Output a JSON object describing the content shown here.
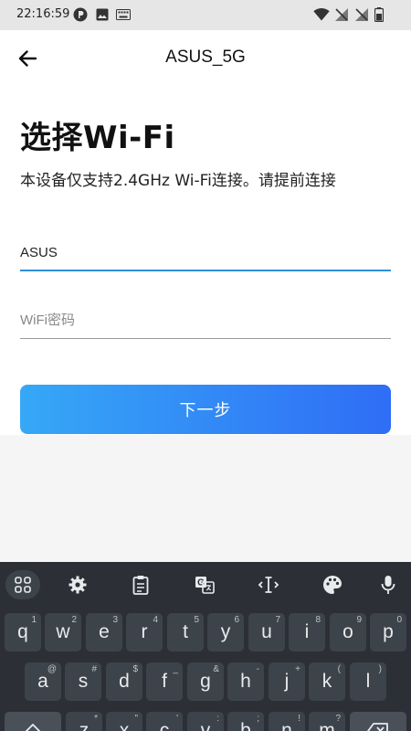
{
  "status_bar": {
    "time": "22:16:59",
    "notification_icons": [
      "app-p-icon",
      "image-icon",
      "keyboard-icon"
    ],
    "system_icons": [
      "wifi-icon",
      "signal-off-icon",
      "signal-off-icon",
      "battery-icon"
    ]
  },
  "app_bar": {
    "back_icon": "arrow-left-icon",
    "title": "ASUS_5G"
  },
  "main": {
    "heading": "选择Wi-Fi",
    "description": "本设备仅支持2.4GHz Wi-Fi连接。请提前连接",
    "ssid_field": {
      "value": "ASUS",
      "placeholder": ""
    },
    "password_field": {
      "value": "",
      "placeholder": "WiFi密码"
    },
    "next_button": "下一步"
  },
  "colors": {
    "accent": "#2f8fd6",
    "button_gradient_start": "#36a8f6",
    "button_gradient_end": "#2f6df6",
    "keyboard_bg": "#2c3036",
    "key_bg": "#3d434a"
  },
  "keyboard": {
    "toolbar": [
      "apps-grid-icon",
      "settings-icon",
      "clipboard-icon",
      "translate-icon",
      "text-cursor-icon",
      "palette-icon",
      "mic-icon"
    ],
    "row1": [
      {
        "label": "q",
        "hint": "1"
      },
      {
        "label": "w",
        "hint": "2"
      },
      {
        "label": "e",
        "hint": "3"
      },
      {
        "label": "r",
        "hint": "4"
      },
      {
        "label": "t",
        "hint": "5"
      },
      {
        "label": "y",
        "hint": "6"
      },
      {
        "label": "u",
        "hint": "7"
      },
      {
        "label": "i",
        "hint": "8"
      },
      {
        "label": "o",
        "hint": "9"
      },
      {
        "label": "p",
        "hint": "0"
      }
    ],
    "row2": [
      {
        "label": "a",
        "hint": "@"
      },
      {
        "label": "s",
        "hint": "#"
      },
      {
        "label": "d",
        "hint": "$"
      },
      {
        "label": "f",
        "hint": "_"
      },
      {
        "label": "g",
        "hint": "&"
      },
      {
        "label": "h",
        "hint": "-"
      },
      {
        "label": "j",
        "hint": "+"
      },
      {
        "label": "k",
        "hint": "("
      },
      {
        "label": "l",
        "hint": ")"
      }
    ],
    "row3": [
      {
        "label": "",
        "hint": ""
      },
      {
        "label": "z",
        "hint": "*"
      },
      {
        "label": "x",
        "hint": "\""
      },
      {
        "label": "c",
        "hint": "'"
      },
      {
        "label": "v",
        "hint": ":"
      },
      {
        "label": "b",
        "hint": ";"
      },
      {
        "label": "n",
        "hint": "!"
      },
      {
        "label": "m",
        "hint": "?"
      },
      {
        "label": "",
        "hint": ""
      }
    ]
  }
}
